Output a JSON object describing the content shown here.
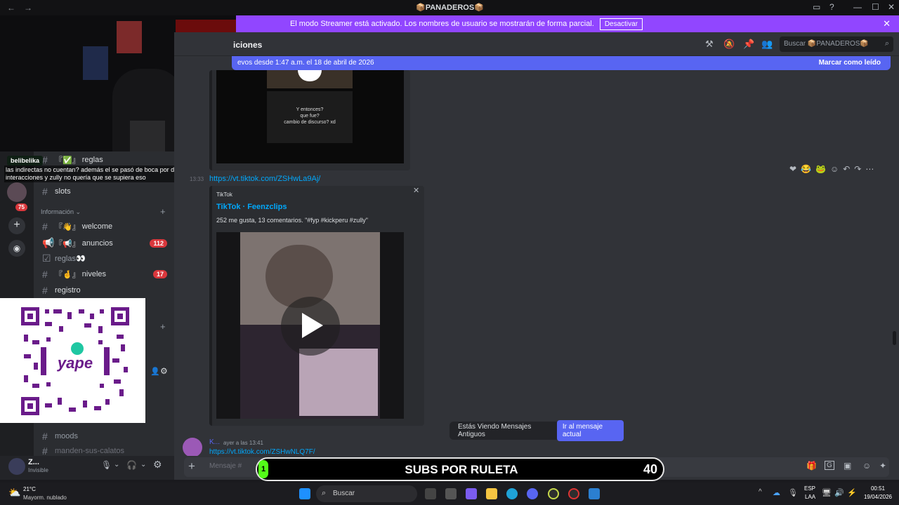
{
  "titlebar": {
    "back": "←",
    "forward": "→",
    "server": "📦PANADEROS📦"
  },
  "streamer_banner": {
    "text": "El modo Streamer está activado. Los nombres de usuario se mostrarán de forma parcial.",
    "button": "Desactivar",
    "color": "#9146ff"
  },
  "header": {
    "title": "iciones",
    "search_placeholder": "Buscar 📦PANADEROS📦"
  },
  "new_messages": {
    "text": "evos desde 1:47 a.m. el 18 de abril de 2026",
    "action": "Marcar como leído"
  },
  "chat_overlay": {
    "user": "belibelika",
    "message": "las indirectas no cuentan? además el se pasó de boca por decir que habían tenido 2 interacciones y zully no quería que se supiera eso"
  },
  "server_badge": "75",
  "sidebar": {
    "channels_top": [
      {
        "name": "reglas",
        "prefix": "『✅』"
      },
      {
        "name": "slots",
        "prefix": ""
      }
    ],
    "category": "Información",
    "channels": [
      {
        "name": "welcome",
        "prefix": "『👋』",
        "badge": ""
      },
      {
        "name": "anuncios",
        "prefix": "『📢』",
        "badge": "112"
      },
      {
        "name": "reglas👀",
        "prefix": "",
        "badge": ""
      },
      {
        "name": "niveles",
        "prefix": "『🤞』",
        "badge": "17"
      },
      {
        "name": "registro",
        "prefix": "",
        "badge": ""
      }
    ],
    "channels_bottom": [
      {
        "name": "moods"
      },
      {
        "name": "manden-sus-calatos"
      }
    ]
  },
  "qr": {
    "brand": "yape"
  },
  "video_top": {
    "caption": "Y entonces?\nque fue?\ncambio de discurso? xd"
  },
  "message": {
    "timestamp": "13:33",
    "link": "https://vt.tiktok.com/ZSHwLa9Aj/",
    "embed_provider": "TikTok",
    "embed_title": "TikTok · Feenzclips",
    "embed_desc": "252 me gusta, 13 comentarios. \"#fyp #kickperu #zully\""
  },
  "last_message": {
    "author": "K...",
    "time": "ayer a las 13:41",
    "link": "https://vt.tiktok.com/ZSHwNLQ7F/"
  },
  "old_messages": {
    "text": "Estás Viendo Mensajes Antiguos",
    "button": "Ir al mensaje actual"
  },
  "user": {
    "name": "Z...",
    "status": "Invisible"
  },
  "compose": {
    "placeholder": "Mensaje #",
    "channel_hint": "reacciones"
  },
  "ruleta": {
    "title": "SUBS POR RULETA",
    "count": "40",
    "timer": "1"
  },
  "taskbar": {
    "temp": "21°C",
    "weather": "Mayorm. nublado",
    "search": "Buscar",
    "lang": "ESP",
    "region": "LAA",
    "time": "00:51",
    "date": "19/04/2026"
  }
}
